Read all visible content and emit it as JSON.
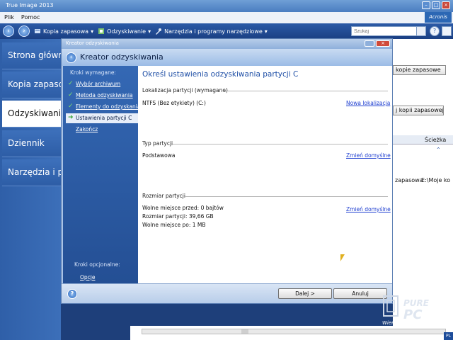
{
  "app": {
    "title": "True Image 2013",
    "brand": "Acronis",
    "menu": [
      "Plik",
      "Pomoc"
    ],
    "toolbar": {
      "backup": "Kopia zapasowa",
      "recovery": "Odzyskiwanie",
      "tools": "Narzędzia i programy narzędziowe"
    },
    "search_placeholder": "Szukaj"
  },
  "leftnav": {
    "items": [
      {
        "label": "Strona główna",
        "active": false
      },
      {
        "label": "Kopia zapasowa",
        "active": false
      },
      {
        "label": "Odzyskiwanie",
        "active": true
      },
      {
        "label": "Dziennik",
        "active": false
      },
      {
        "label": "Narzędzia i programy",
        "active": false
      }
    ]
  },
  "right_panel": {
    "btn_backup": "kopie zapasowe",
    "btn_backup2": "j kopii zapasowej...",
    "col_header": "Ścieżka",
    "row_type": "zapasowa",
    "row_path": "E:\\Moje ko"
  },
  "dialog": {
    "title": "Kreator odzyskiwania",
    "header": "Kreator odzyskiwania",
    "steps_label": "Kroki wymagane:",
    "steps": [
      {
        "label": "Wybór archiwum",
        "done": true,
        "current": false
      },
      {
        "label": "Metoda odzyskiwania",
        "done": true,
        "current": false
      },
      {
        "label": "Elementy do odzyskania",
        "done": true,
        "current": false
      },
      {
        "label": "Ustawienia partycji C",
        "done": false,
        "current": true
      },
      {
        "label": "Zakończ",
        "done": false,
        "current": false
      }
    ],
    "optional_label": "Kroki opcjonalne:",
    "optional_link": "Opcje",
    "panel": {
      "title": "Określ ustawienia odzyskiwania partycji C",
      "location_header": "Lokalizacja partycji (wymagane)",
      "location_value": "NTFS (Bez etykiety) (C:)",
      "location_link": "Nowa lokalizacja",
      "type_header": "Typ partycji",
      "type_value": "Podstawowa",
      "type_link": "Zmień domyślne",
      "size_header": "Rozmiar partycji",
      "size_free_before": "Wolne miejsce przed: 0 bajtów",
      "size_partition": "Rozmiar partycji: 39,66 GB",
      "size_free_after": "Wolne miejsce po: 1 MB",
      "size_link": "Zmień domyślne"
    },
    "buttons": {
      "next": "Dalej >",
      "cancel": "Anuluj"
    }
  },
  "watermark": {
    "text": "PurePC",
    "slogan": "Wiemy, co się kręci !",
    "lang": "PL"
  },
  "colors": {
    "accent": "#1f4fa6",
    "nav_bg": "#2f5fa8",
    "link": "#1f3fd0"
  }
}
